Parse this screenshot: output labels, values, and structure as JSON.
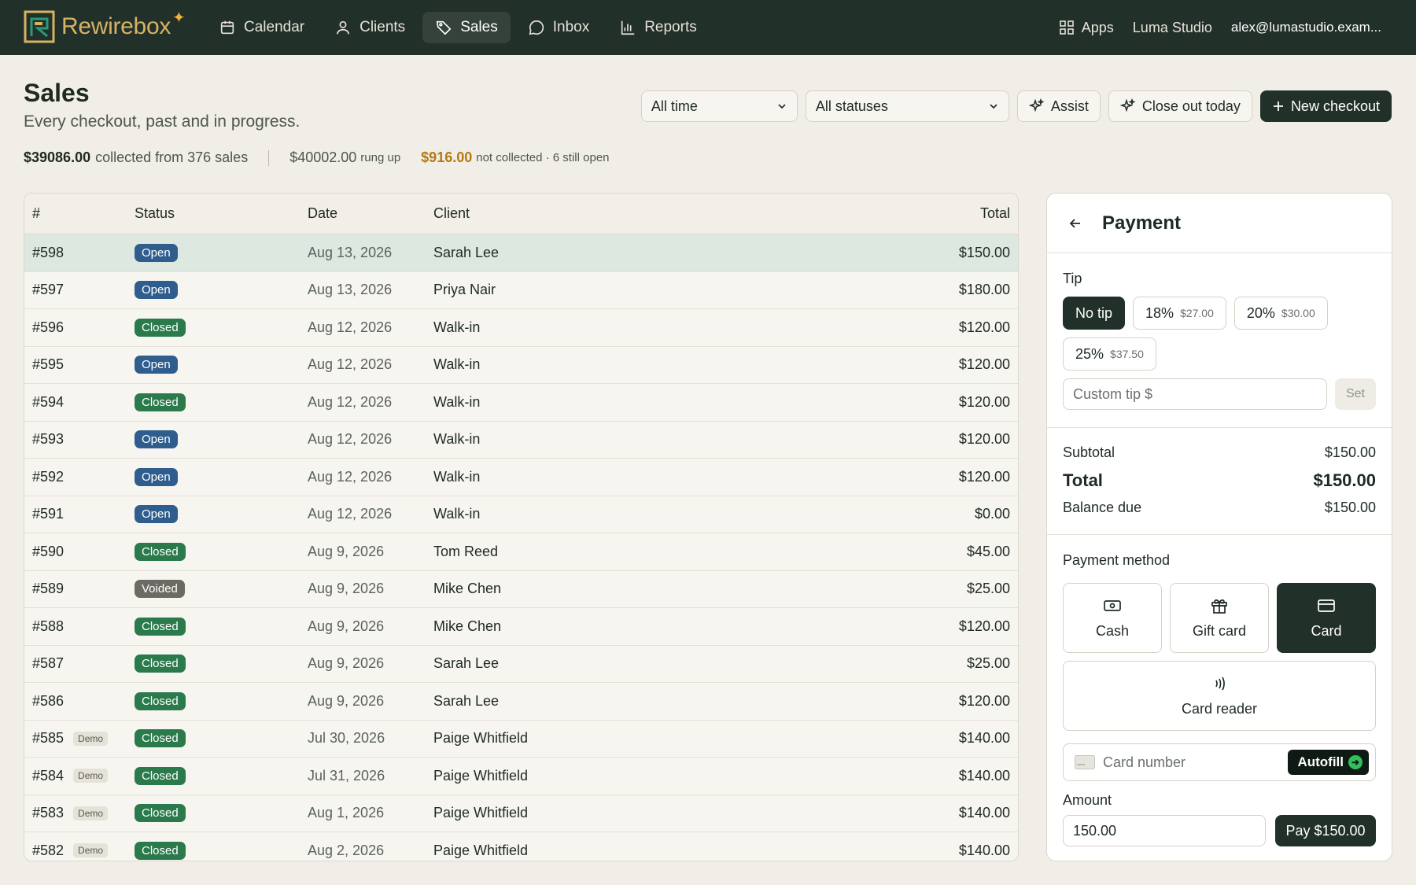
{
  "app": {
    "name": "Rewirebox",
    "brand_color": "#22302a",
    "accent_color": "#d6b263"
  },
  "nav": [
    {
      "label": "Calendar",
      "icon": "calendar-icon",
      "active": false
    },
    {
      "label": "Clients",
      "icon": "user-icon",
      "active": false
    },
    {
      "label": "Sales",
      "icon": "tag-icon",
      "active": true
    },
    {
      "label": "Inbox",
      "icon": "chat-icon",
      "active": false
    },
    {
      "label": "Reports",
      "icon": "bar-chart-icon",
      "active": false
    }
  ],
  "topright": {
    "apps_label": "Apps",
    "studio": "Luma Studio",
    "email": "alex@lumastudio.exam..."
  },
  "header": {
    "title": "Sales",
    "subtitle": "Every checkout, past and in progress.",
    "time_filter": "All time",
    "status_filter": "All statuses",
    "assist_label": "Assist",
    "close_out_label": "Close out today",
    "new_checkout_label": "New checkout"
  },
  "stats": {
    "collected": "$39086.00",
    "collected_text": "collected from 376 sales",
    "rung_up": "$40002.00",
    "rung_up_text": "rung up",
    "not_collected": "$916.00",
    "not_collected_text": "not collected · 6 still open"
  },
  "table": {
    "columns": [
      "#",
      "Status",
      "Date",
      "Client",
      "Total"
    ],
    "rows": [
      {
        "num": "#598",
        "demo": "",
        "status": "Open",
        "date": "Aug 13, 2026",
        "client": "Sarah Lee",
        "total": "$150.00"
      },
      {
        "num": "#597",
        "demo": "",
        "status": "Open",
        "date": "Aug 13, 2026",
        "client": "Priya Nair",
        "total": "$180.00"
      },
      {
        "num": "#596",
        "demo": "",
        "status": "Closed",
        "date": "Aug 12, 2026",
        "client": "Walk-in",
        "total": "$120.00"
      },
      {
        "num": "#595",
        "demo": "",
        "status": "Open",
        "date": "Aug 12, 2026",
        "client": "Walk-in",
        "total": "$120.00"
      },
      {
        "num": "#594",
        "demo": "",
        "status": "Closed",
        "date": "Aug 12, 2026",
        "client": "Walk-in",
        "total": "$120.00"
      },
      {
        "num": "#593",
        "demo": "",
        "status": "Open",
        "date": "Aug 12, 2026",
        "client": "Walk-in",
        "total": "$120.00"
      },
      {
        "num": "#592",
        "demo": "",
        "status": "Open",
        "date": "Aug 12, 2026",
        "client": "Walk-in",
        "total": "$120.00"
      },
      {
        "num": "#591",
        "demo": "",
        "status": "Open",
        "date": "Aug 12, 2026",
        "client": "Walk-in",
        "total": "$0.00"
      },
      {
        "num": "#590",
        "demo": "",
        "status": "Closed",
        "date": "Aug 9, 2026",
        "client": "Tom Reed",
        "total": "$45.00"
      },
      {
        "num": "#589",
        "demo": "",
        "status": "Voided",
        "date": "Aug 9, 2026",
        "client": "Mike Chen",
        "total": "$25.00"
      },
      {
        "num": "#588",
        "demo": "",
        "status": "Closed",
        "date": "Aug 9, 2026",
        "client": "Mike Chen",
        "total": "$120.00"
      },
      {
        "num": "#587",
        "demo": "",
        "status": "Closed",
        "date": "Aug 9, 2026",
        "client": "Sarah Lee",
        "total": "$25.00"
      },
      {
        "num": "#586",
        "demo": "",
        "status": "Closed",
        "date": "Aug 9, 2026",
        "client": "Sarah Lee",
        "total": "$120.00"
      },
      {
        "num": "#585",
        "demo": "Demo",
        "status": "Closed",
        "date": "Jul 30, 2026",
        "client": "Paige Whitfield",
        "total": "$140.00"
      },
      {
        "num": "#584",
        "demo": "Demo",
        "status": "Closed",
        "date": "Jul 31, 2026",
        "client": "Paige Whitfield",
        "total": "$140.00"
      },
      {
        "num": "#583",
        "demo": "Demo",
        "status": "Closed",
        "date": "Aug 1, 2026",
        "client": "Paige Whitfield",
        "total": "$140.00"
      },
      {
        "num": "#582",
        "demo": "Demo",
        "status": "Closed",
        "date": "Aug 2, 2026",
        "client": "Paige Whitfield",
        "total": "$140.00"
      }
    ]
  },
  "payment": {
    "title": "Payment",
    "tip_label": "Tip",
    "tips": [
      {
        "label": "No tip",
        "amount": "",
        "selected": true
      },
      {
        "label": "18%",
        "amount": "$27.00",
        "selected": false
      },
      {
        "label": "20%",
        "amount": "$30.00",
        "selected": false
      },
      {
        "label": "25%",
        "amount": "$37.50",
        "selected": false
      }
    ],
    "custom_tip_placeholder": "Custom tip $",
    "set_label": "Set",
    "subtotal_label": "Subtotal",
    "subtotal": "$150.00",
    "total_label": "Total",
    "total": "$150.00",
    "balance_label": "Balance due",
    "balance": "$150.00",
    "method_label": "Payment method",
    "methods": [
      {
        "label": "Cash",
        "icon": "cash-icon",
        "selected": false
      },
      {
        "label": "Gift card",
        "icon": "gift-icon",
        "selected": false
      },
      {
        "label": "Card",
        "icon": "card-icon",
        "selected": true
      },
      {
        "label": "Card reader",
        "icon": "contactless-icon",
        "selected": false
      }
    ],
    "card_number_placeholder": "Card number",
    "autofill_label": "Autofill",
    "amount_label": "Amount",
    "amount_value": "150.00",
    "pay_label": "Pay $150.00"
  }
}
